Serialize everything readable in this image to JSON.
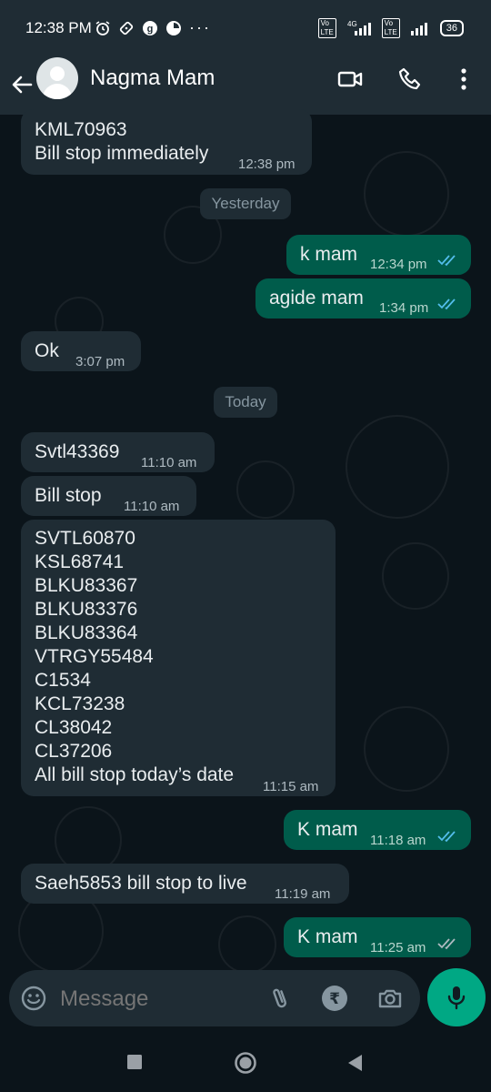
{
  "status_bar": {
    "time": "12:38 PM",
    "network": "4G",
    "battery": "36",
    "overflow": "···"
  },
  "header": {
    "contact_name": "Nagma Mam",
    "icons": [
      "back-arrow-icon",
      "avatar",
      "video-call-icon",
      "phone-icon",
      "more-options-icon"
    ]
  },
  "messages": [
    {
      "dir": "in",
      "text": "KML70963\nBill stop immediately",
      "time": "12:38 pm"
    },
    {
      "type": "date",
      "text": "Yesterday"
    },
    {
      "dir": "out",
      "text": "k mam",
      "time": "12:34 pm",
      "read": true
    },
    {
      "dir": "out",
      "text": "agide mam",
      "time": "1:34 pm",
      "read": true
    },
    {
      "dir": "in",
      "text": "Ok",
      "time": "3:07 pm"
    },
    {
      "type": "date",
      "text": "Today"
    },
    {
      "dir": "in",
      "text": "Svtl43369",
      "time": "11:10 am"
    },
    {
      "dir": "in",
      "text": "Bill stop",
      "time": "11:10 am"
    },
    {
      "dir": "in",
      "text": "SVTL60870\nKSL68741\nBLKU83367\nBLKU83376\nBLKU83364\nVTRGY55484\nC1534\nKCL73238\nCL38042\nCL37206\nAll bill stop today’s date",
      "time": "11:15 am"
    },
    {
      "dir": "out",
      "text": "K mam",
      "time": "11:18 am",
      "read": true
    },
    {
      "dir": "in",
      "text": "Saeh5853 bill stop to live",
      "time": "11:19 am"
    },
    {
      "dir": "out",
      "text": "K mam",
      "time": "11:25 am",
      "read": true
    }
  ],
  "composer": {
    "placeholder": "Message"
  },
  "colors": {
    "background": "#0b141a",
    "incoming_bubble": "#1f2c34",
    "outgoing_bubble": "#005c4b",
    "accent": "#00a884",
    "read_ticks": "#53bdeb"
  }
}
